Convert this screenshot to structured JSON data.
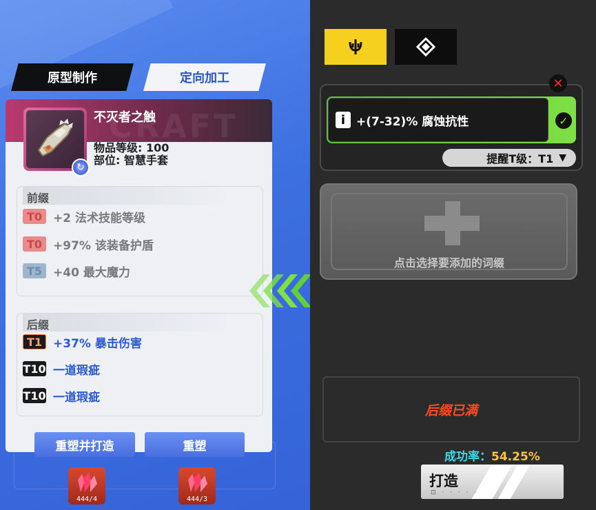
{
  "tabs": {
    "prototype": "原型制作",
    "directional": "定向加工"
  },
  "item": {
    "name": "不灭者之触",
    "level_line": "物品等级: 100",
    "slot_line": "部位: 智慧手套"
  },
  "prefix": {
    "title": "前缀",
    "affixes": [
      {
        "tier": "T0",
        "text": "+2 法术技能等级"
      },
      {
        "tier": "T0",
        "text": "+97% 该装备护盾"
      },
      {
        "tier": "T5",
        "text": "+40 最大魔力"
      }
    ]
  },
  "suffix": {
    "title": "后缀",
    "affixes": [
      {
        "tier": "T1",
        "text": "+37% 暴击伤害"
      },
      {
        "tier": "T10",
        "text": "一道瑕疵"
      },
      {
        "tier": "T10",
        "text": "一道瑕疵"
      }
    ]
  },
  "buttons": {
    "reshape_craft": "重塑并打造",
    "reshape": "重塑"
  },
  "materials": [
    {
      "count": "444/4"
    },
    {
      "count": "444/3"
    }
  ],
  "right": {
    "selected_affix": "+(7-32)% 腐蚀抗性",
    "reminder_tier": "提醒T级：T1",
    "add_prompt": "点击选择要添加的词缀",
    "status": "后缀已满",
    "success_label": "成功率：",
    "success_value": "54.25%",
    "craft_button": "打造"
  },
  "colors": {
    "accent_yellow": "#f5d01f",
    "success_green": "#7ee044",
    "warning_red": "#ff4b1f",
    "panel_blue": "#3c6fe0"
  }
}
